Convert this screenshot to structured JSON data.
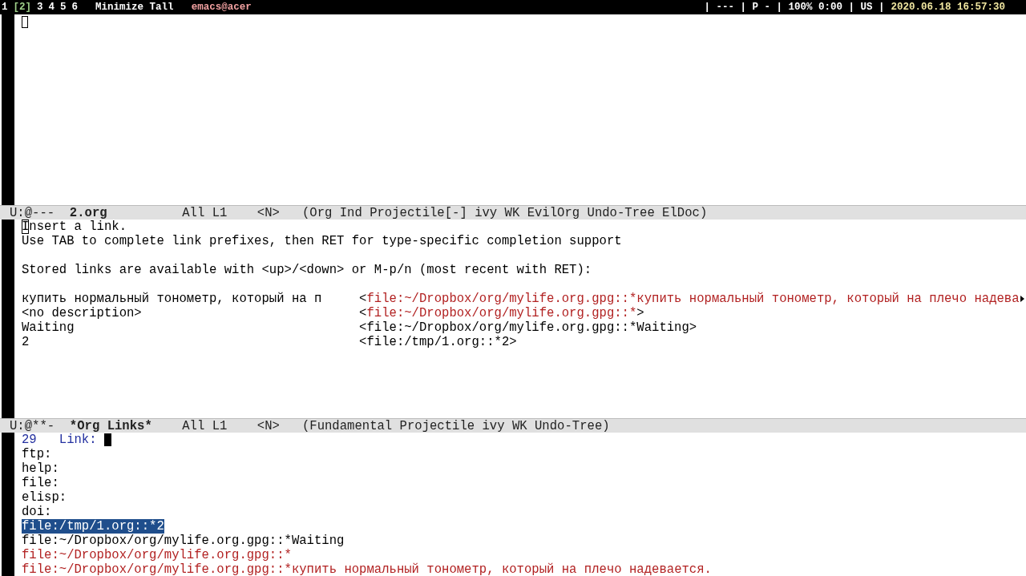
{
  "top_bar": {
    "workspaces": [
      {
        "label": "1",
        "selected": false
      },
      {
        "label": "[2]",
        "selected": true
      },
      {
        "label": "3",
        "selected": false
      },
      {
        "label": "4",
        "selected": false
      },
      {
        "label": "5",
        "selected": false
      },
      {
        "label": "6",
        "selected": false
      }
    ],
    "layout": "Minimize Tall",
    "window_title": "emacs@acer",
    "status": "| --- | P - | 100% 0:00 | US |",
    "clock": "2020.06.18 16:57:30"
  },
  "windows": [
    {
      "mode_line": {
        "state": "U:@---",
        "buffer": "2.org",
        "position": "All L1",
        "evil_state": "<N>",
        "modes": "(Org Ind Projectile[-] ivy WK EvilOrg Undo-Tree ElDoc)"
      }
    },
    {
      "intro": [
        "Insert a link.",
        "Use TAB to complete link prefixes, then RET for type-specific completion support"
      ],
      "hint": "Stored links are available with <up>/<down> or M-p/n (most recent with RET):",
      "stored_links": [
        {
          "description": "купить нормальный тонометр, который на п",
          "open": "<",
          "link": "file:~/Dropbox/org/mylife.org.gpg::*купить нормальный тонометр, который на плечо надева",
          "color": "#b22222",
          "continued": true
        },
        {
          "description": "<no description>",
          "open": "<",
          "link": "file:~/Dropbox/org/mylife.org.gpg::*",
          "close": ">",
          "color": "#b22222",
          "continued": false
        },
        {
          "description": "Waiting",
          "open": "<",
          "link": "file:~/Dropbox/org/mylife.org.gpg::*Waiting",
          "close": ">",
          "color": "#000000",
          "continued": false
        },
        {
          "description": "2",
          "open": "<",
          "link": "file:/tmp/1.org::*2",
          "close": ">",
          "color": "#000000",
          "continued": false
        }
      ],
      "mode_line": {
        "state": "U:@**-",
        "buffer": "*Org Links*",
        "position": "All L1",
        "evil_state": "<N>",
        "modes": "(Fundamental Projectile ivy WK Undo-Tree)"
      }
    }
  ],
  "minibuffer": {
    "count": "29",
    "prompt": "Link:",
    "candidates": [
      {
        "text": "ftp:",
        "selected": false,
        "color": "#000000"
      },
      {
        "text": "help:",
        "selected": false,
        "color": "#000000"
      },
      {
        "text": "file:",
        "selected": false,
        "color": "#000000"
      },
      {
        "text": "elisp:",
        "selected": false,
        "color": "#000000"
      },
      {
        "text": "doi:",
        "selected": false,
        "color": "#000000"
      },
      {
        "text": "file:/tmp/1.org::*2",
        "selected": true
      },
      {
        "text": "file:~/Dropbox/org/mylife.org.gpg::*Waiting",
        "selected": false,
        "color": "#000000"
      },
      {
        "text": "file:~/Dropbox/org/mylife.org.gpg::*",
        "selected": false,
        "color": "#b22222"
      },
      {
        "text": "file:~/Dropbox/org/mylife.org.gpg::*купить нормальный тонометр, который на плечо надевается.",
        "selected": false,
        "color": "#b22222"
      }
    ]
  }
}
